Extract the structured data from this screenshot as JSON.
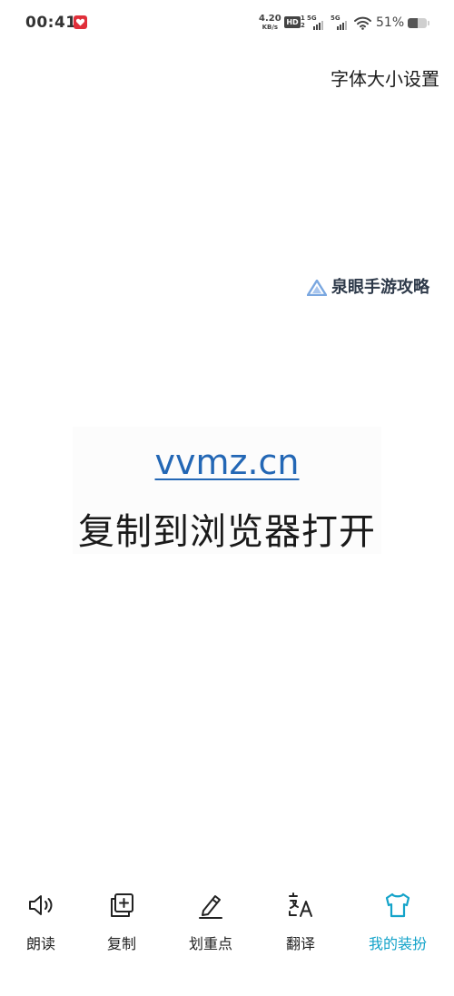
{
  "status_bar": {
    "time": "00:41",
    "net_speed_value": "4.20",
    "net_speed_unit": "KB/s",
    "hd_label": "HD",
    "hd_sub": "1\n2",
    "sim1_label": "5G",
    "sim2_label": "5G",
    "battery_percent": "51%",
    "battery_level": 0.51,
    "notification_icon": "heart-app-icon"
  },
  "header": {
    "font_size_setting": "字体大小设置"
  },
  "watermark": {
    "text": "泉眼手游攻略"
  },
  "content": {
    "link_text": "vvmz.cn",
    "hint_text": "复制到浏览器打开"
  },
  "toolbar": {
    "items": [
      {
        "label": "朗读",
        "icon": "speaker-icon",
        "active": false
      },
      {
        "label": "复制",
        "icon": "copy-icon",
        "active": false
      },
      {
        "label": "划重点",
        "icon": "pen-icon",
        "active": false
      },
      {
        "label": "翻译",
        "icon": "translate-icon",
        "active": false
      },
      {
        "label": "我的装扮",
        "icon": "tshirt-icon",
        "active": true
      }
    ]
  },
  "colors": {
    "accent": "#13a3c9",
    "link": "#2367b5",
    "notification": "#e02f3a"
  }
}
